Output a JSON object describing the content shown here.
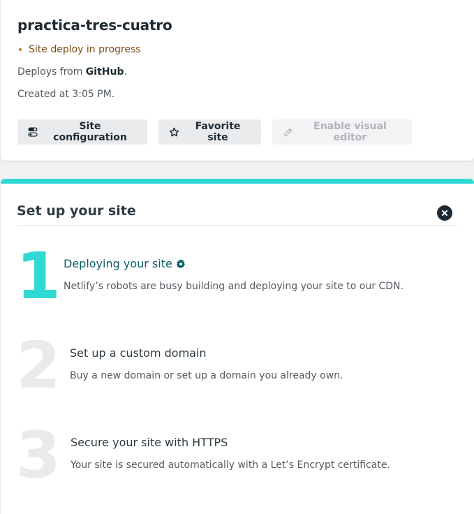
{
  "site": {
    "name": "practica-tres-cuatro",
    "status": "Site deploy in progress",
    "deploys_prefix": "Deploys from ",
    "deploys_source": "GitHub",
    "deploys_suffix": ".",
    "created": "Created at 3:05 PM."
  },
  "actions": {
    "site_configuration": "Site configuration",
    "favorite_site": "Favorite site",
    "enable_visual_editor": "Enable visual editor"
  },
  "setup": {
    "title": "Set up your site",
    "steps": [
      {
        "number": "1",
        "title": "Deploying your site",
        "description": "Netlify’s robots are busy building and deploying your site to our CDN."
      },
      {
        "number": "2",
        "title": "Set up a custom domain",
        "description": "Buy a new domain or set up a domain you already own."
      },
      {
        "number": "3",
        "title": "Secure your site with HTTPS",
        "description": "Your site is secured automatically with a Let’s Encrypt certificate."
      }
    ]
  },
  "colors": {
    "accent": "#30d9d4",
    "status": "#7a4a12",
    "step_active": "#0b5e67"
  },
  "icons": {
    "status": "dot-icon",
    "config": "toggle-settings-icon",
    "favorite": "star-icon",
    "visual_editor": "pencil-icon",
    "close": "close-icon",
    "deploying": "gear-icon"
  }
}
